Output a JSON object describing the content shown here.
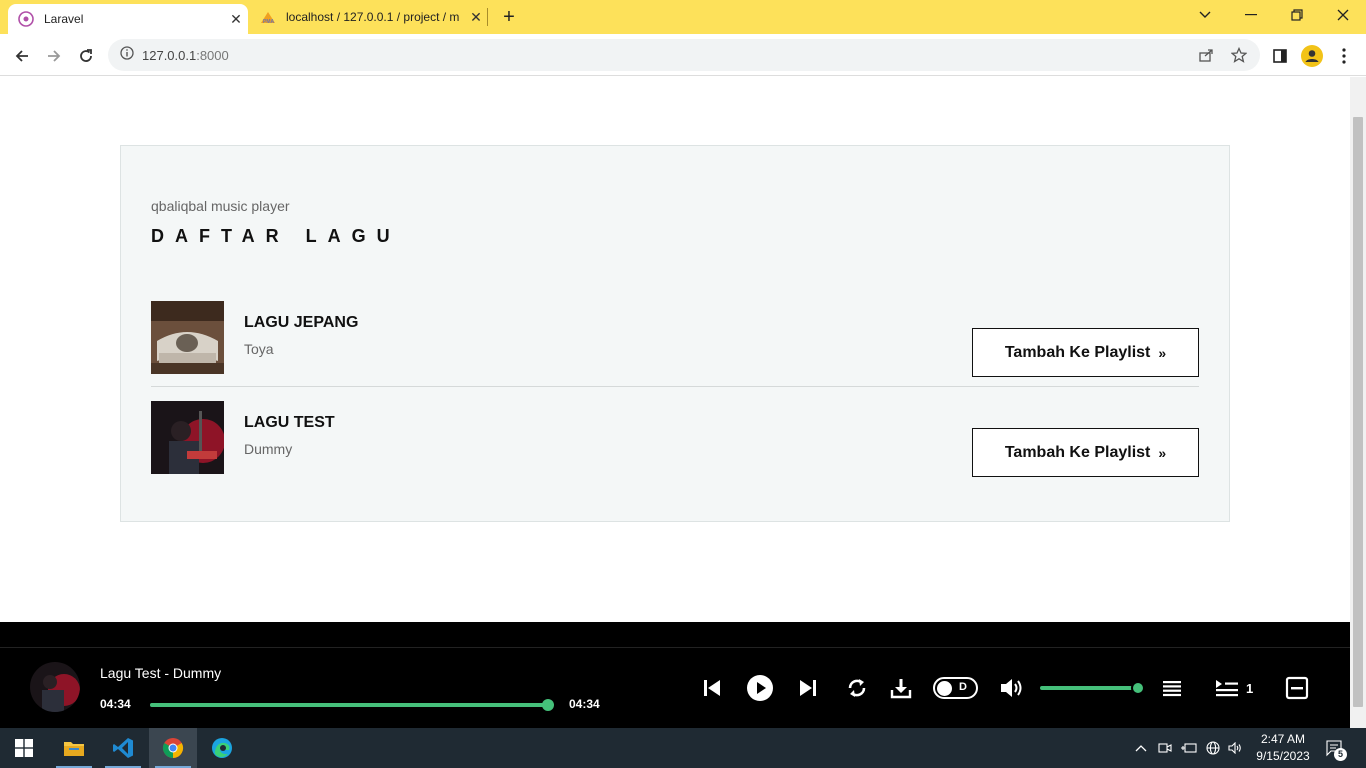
{
  "browser": {
    "tabs": [
      {
        "title": "Laravel",
        "active": true
      },
      {
        "title": "localhost / 127.0.0.1 / project / m",
        "active": false
      }
    ],
    "url_host": "127.0.0.1",
    "url_port": ":8000"
  },
  "page": {
    "subtitle": "qbaliqbal music player",
    "heading": "DAFTAR LAGU",
    "songs": [
      {
        "title": "LAGU JEPANG",
        "artist": "Toya",
        "button": "Tambah Ke Playlist"
      },
      {
        "title": "LAGU TEST",
        "artist": "Dummy",
        "button": "Tambah Ke Playlist"
      }
    ]
  },
  "player": {
    "now_playing": "Lagu Test - Dummy",
    "current_time": "04:34",
    "total_time": "04:34",
    "progress": 1.0,
    "toggle_label": "D",
    "volume": 1.0,
    "queue_count": "1",
    "accent": "#45c07a"
  },
  "taskbar": {
    "time": "2:47 AM",
    "date": "9/15/2023",
    "notifications": "5"
  }
}
